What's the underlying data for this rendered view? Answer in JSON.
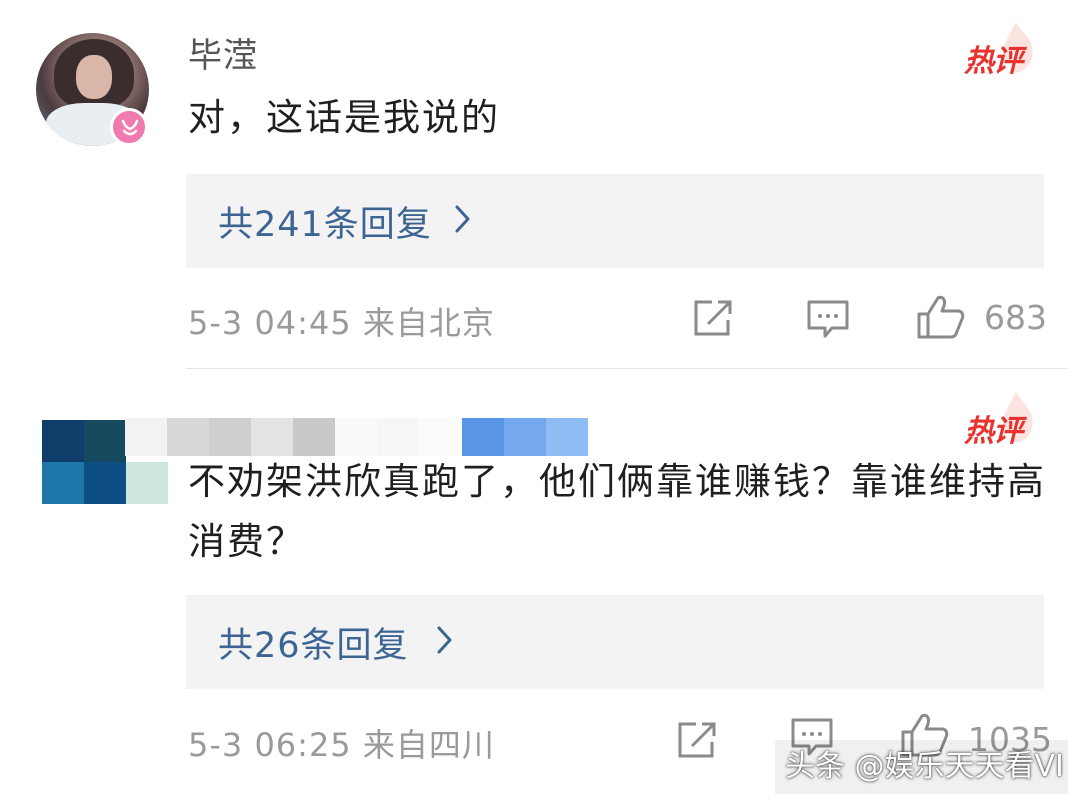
{
  "hot_tag_label": "热评",
  "comments": [
    {
      "username": "毕滢",
      "content": "对，这话是我说的",
      "replies_label": "共241条回复",
      "time_location": "5-3 04:45 来自北京",
      "like_count": "683"
    },
    {
      "username": "",
      "content": "不劝架洪欣真跑了，他们俩靠谁赚钱？靠谁维持高消费？",
      "replies_label": "共26条回复",
      "time_location": "5-3 06:25 来自四川",
      "like_count": "1035"
    }
  ],
  "watermark": "头条 @娱乐天天看VI",
  "colors": {
    "reply_link": "#3d6593",
    "hot_tag": "#e8332f",
    "meta_text": "#9a9a9a",
    "reply_bg": "#f3f3f3",
    "badge": "#f07bb0"
  },
  "icons": [
    "share-icon",
    "comment-icon",
    "thumbs-up-icon",
    "chevron-right-icon",
    "flame-icon",
    "vip-badge-icon"
  ]
}
